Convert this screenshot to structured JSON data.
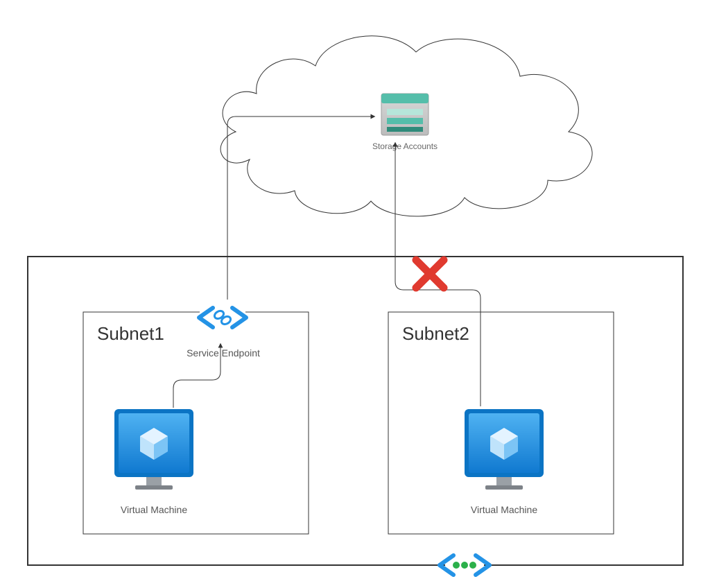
{
  "cloud": {
    "storage_label": "Storage Accounts"
  },
  "vnet": {
    "subnet1": {
      "title": "Subnet1",
      "endpoint_label": "Service Endpoint",
      "vm_label": "Virtual Machine"
    },
    "subnet2": {
      "title": "Subnet2",
      "vm_label": "Virtual Machine"
    }
  },
  "icons": {
    "storage": "storage-icon",
    "vm": "vm-icon",
    "service_endpoint": "service-endpoint-icon",
    "peering": "peering-icon",
    "deny": "deny-icon"
  },
  "colors": {
    "azure_blue": "#2493e6",
    "azure_blue_dark": "#0b74c4",
    "teal": "#55beaa",
    "teal_dark": "#2f8b7a",
    "deny_red": "#e03a2f",
    "peer_green": "#2bb04a",
    "gray": "#8c8c8c"
  }
}
